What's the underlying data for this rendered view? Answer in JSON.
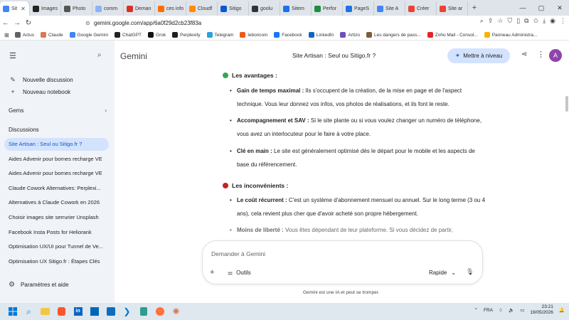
{
  "browser": {
    "tabs": [
      {
        "label": "Sit",
        "color": "#4285f4",
        "active": true
      },
      {
        "label": "Images",
        "color": "#222222"
      },
      {
        "label": "Photo",
        "color": "#555555"
      },
      {
        "label": "comm",
        "color": "#8ab4f8"
      },
      {
        "label": "Deman",
        "color": "#d93025"
      },
      {
        "label": "ces info",
        "color": "#ff6d00"
      },
      {
        "label": "Cloudf",
        "color": "#ff8c00"
      },
      {
        "label": "Sitigo",
        "color": "#0b57d0"
      },
      {
        "label": "goolu",
        "color": "#333333"
      },
      {
        "label": "Sitem",
        "color": "#1a73e8"
      },
      {
        "label": "Perfor",
        "color": "#1e8e3e"
      },
      {
        "label": "PageS",
        "color": "#1a73e8"
      },
      {
        "label": "Site A",
        "color": "#4285f4"
      },
      {
        "label": "Créer",
        "color": "#ea4335"
      },
      {
        "label": "Site ar",
        "color": "#ea4335"
      }
    ],
    "url": "gemini.google.com/app/6a0f29d2cb23f83a",
    "bookmarks": [
      {
        "label": "Actus",
        "color": "#5f6368"
      },
      {
        "label": "Claude",
        "color": "#d97757"
      },
      {
        "label": "Google Gemini",
        "color": "#4285f4"
      },
      {
        "label": "ChatGPT",
        "color": "#222222"
      },
      {
        "label": "Grok",
        "color": "#111111"
      },
      {
        "label": "Perplexity",
        "color": "#1f1f1f"
      },
      {
        "label": "Telegram",
        "color": "#2aa1da"
      },
      {
        "label": "leboncoin",
        "color": "#ec5a13"
      },
      {
        "label": "Facebook",
        "color": "#1877f2"
      },
      {
        "label": "LinkedIn",
        "color": "#0a66c2"
      },
      {
        "label": "Artizo",
        "color": "#6b4fbb"
      },
      {
        "label": "Les dangers de pass...",
        "color": "#7b5e3b"
      },
      {
        "label": "Zoho Mail - Consol...",
        "color": "#e42527"
      },
      {
        "label": "Panneau Administra...",
        "color": "#f4b400"
      }
    ]
  },
  "sidebar": {
    "new_chat": "Nouvelle discussion",
    "new_notebook": "Nouveau notebook",
    "gems": "Gems",
    "discussions_heading": "Discussions",
    "conversations": [
      "Site Artisan : Seul ou Sitigo.fr ?",
      "Aides Advenir pour bornes recharge VE",
      "Aides Advenir pour bornes recharge VE",
      "Claude Cowork Alternatives: Perplexi...",
      "Alternatives à Claude Cowork en 2026",
      "Choisir images site serrurier Unsplash",
      "Facebook Insta Posts for Heliorank",
      "Optimisation UX/UI pour Tunnel de Ve...",
      "Optimisation UX Sitigo.fr : Étapes Clés"
    ],
    "settings": "Paramètres et aide"
  },
  "header": {
    "app_name": "Gemini",
    "chat_title": "Site Artisan : Seul ou Sitigo.fr ?",
    "upgrade_label": "Mettre à niveau",
    "avatar_letter": "A"
  },
  "content": {
    "advantages": {
      "title": "Les avantages :",
      "color": "#34a853",
      "items": [
        {
          "bold": "Gain de temps maximal :",
          "text": " Ils s'occupent de la création, de la mise en page et de l'aspect technique. Vous leur donnez vos infos, vos photos de réalisations, et ils font le reste."
        },
        {
          "bold": "Accompagnement et SAV :",
          "text": " Si le site plante ou si vous voulez changer un numéro de téléphone, vous avez un interlocuteur pour le faire à votre place."
        },
        {
          "bold": "Clé en main :",
          "text": " Le site est généralement optimisé dès le départ pour le mobile et les aspects de base du référencement."
        }
      ]
    },
    "disadvantages": {
      "title": "Les inconvénients :",
      "color": "#c5221f",
      "items": [
        {
          "bold": "Le coût récurrent :",
          "text": " C'est un système d'abonnement mensuel ou annuel. Sur le long terme (3 ou 4 ans), cela revient plus cher que d'avoir acheté son propre hébergement."
        },
        {
          "bold": "Moins de liberté :",
          "text": " Vous êtes dépendant de leur plateforme. Si vous décidez de partir,"
        }
      ]
    }
  },
  "composer": {
    "placeholder": "Demander à Gemini",
    "tools_label": "Outils",
    "model_label": "Rapide"
  },
  "disclaimer": "Gemini est une IA et peut se tromper.",
  "taskbar": {
    "lang": "FRA",
    "time": "23:21",
    "date": "19/05/2026"
  }
}
